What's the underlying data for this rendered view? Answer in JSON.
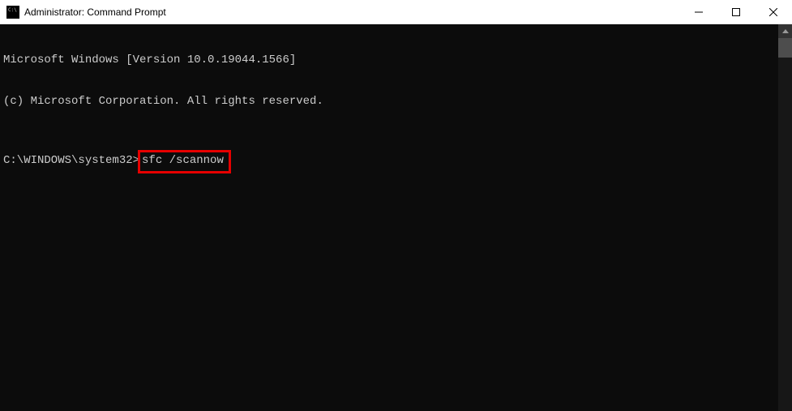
{
  "window": {
    "title": "Administrator: Command Prompt"
  },
  "terminal": {
    "banner_line1": "Microsoft Windows [Version 10.0.19044.1566]",
    "banner_line2": "(c) Microsoft Corporation. All rights reserved.",
    "prompt": "C:\\WINDOWS\\system32>",
    "command": "sfc /scannow"
  }
}
